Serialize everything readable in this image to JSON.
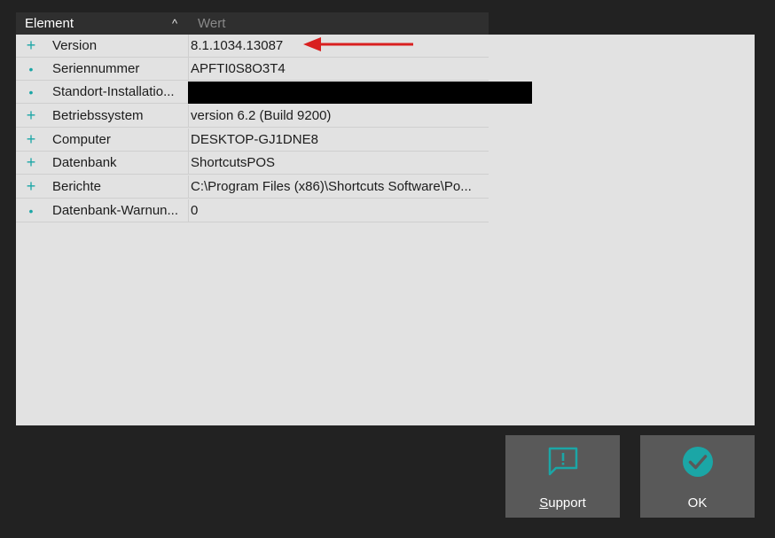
{
  "columns": {
    "element": "Element",
    "wert": "Wert",
    "sort_indicator": "^"
  },
  "rows": [
    {
      "marker": "+",
      "name": "Version",
      "value": "8.1.1034.13087"
    },
    {
      "marker": "•",
      "name": "Seriennummer",
      "value": "APFTI0S8O3T4"
    },
    {
      "marker": "•",
      "name": "Standort-Installatio...",
      "value": ""
    },
    {
      "marker": "+",
      "name": "Betriebssystem",
      "value": "version 6.2  (Build 9200)"
    },
    {
      "marker": "+",
      "name": "Computer",
      "value": "DESKTOP-GJ1DNE8"
    },
    {
      "marker": "+",
      "name": "Datenbank",
      "value": "ShortcutsPOS"
    },
    {
      "marker": "+",
      "name": "Berichte",
      "value": "C:\\Program Files (x86)\\Shortcuts Software\\Po..."
    },
    {
      "marker": "•",
      "name": "Datenbank-Warnun...",
      "value": "0"
    }
  ],
  "buttons": {
    "support": {
      "label_underlined": "S",
      "label_rest": "upport",
      "icon": "feedback-icon"
    },
    "ok": {
      "label": "OK",
      "icon": "check-circle-icon"
    }
  },
  "colors": {
    "accent": "#1ba6a6",
    "arrow": "#d92020",
    "button_bg": "#595959"
  }
}
